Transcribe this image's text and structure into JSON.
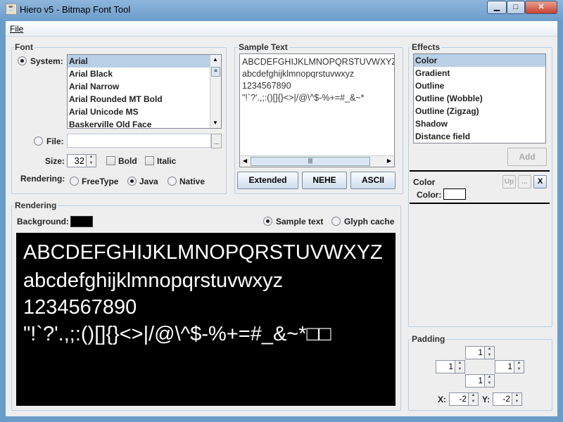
{
  "window": {
    "title": "Hiero v5 - Bitmap Font Tool",
    "minimize": "▁",
    "maximize": "□",
    "close": "✕"
  },
  "menu": {
    "file": "File"
  },
  "font": {
    "legend": "Font",
    "system_label": "System:",
    "fonts": [
      "Arial",
      "Arial Black",
      "Arial Narrow",
      "Arial Rounded MT Bold",
      "Arial Unicode MS",
      "Baskerville Old Face"
    ],
    "selected": "Arial",
    "file_label": "File:",
    "file_value": "",
    "browse": "...",
    "size_label": "Size:",
    "size": "32",
    "bold": "Bold",
    "italic": "Italic",
    "rendering_label": "Rendering:",
    "modes": [
      "FreeType",
      "Java",
      "Native"
    ],
    "mode_selected": "Java"
  },
  "sample": {
    "legend": "Sample Text",
    "lines": [
      "ABCDEFGHIJKLMNOPQRSTUVWXYZ",
      "abcdefghijklmnopqrstuvwxyz",
      "1234567890",
      "\"!`?'.,;:()[]{}<>|/@\\^$-%+=#_&~*"
    ],
    "buttons": [
      "Extended",
      "NEHE",
      "ASCII"
    ]
  },
  "effects": {
    "legend": "Effects",
    "items": [
      "Color",
      "Gradient",
      "Outline",
      "Outline (Wobble)",
      "Outline (Zigzag)",
      "Shadow",
      "Distance field"
    ],
    "selected": "Color",
    "add": "Add",
    "panel_title": "Color",
    "up": "Up",
    "more": "...",
    "remove": "X",
    "color_label": "Color:",
    "color_value": "#ffffff"
  },
  "rendering": {
    "legend": "Rendering",
    "background_label": "Background:",
    "background_color": "#000000",
    "sample_text": "Sample text",
    "glyph_cache": "Glyph cache",
    "view_selected": "Sample text",
    "lines": [
      "ABCDEFGHIJKLMNOPQRSTUVWXYZ",
      "abcdefghijklmnopqrstuvwxyz",
      "1234567890",
      "\"!`?'.,;:()[]{}<>|/@\\^$-%+=#_&~*□□"
    ]
  },
  "padding": {
    "legend": "Padding",
    "top": "1",
    "left": "1",
    "right": "1",
    "bottom": "1",
    "x_label": "X:",
    "x": "-2",
    "y_label": "Y:",
    "y": "-2"
  }
}
